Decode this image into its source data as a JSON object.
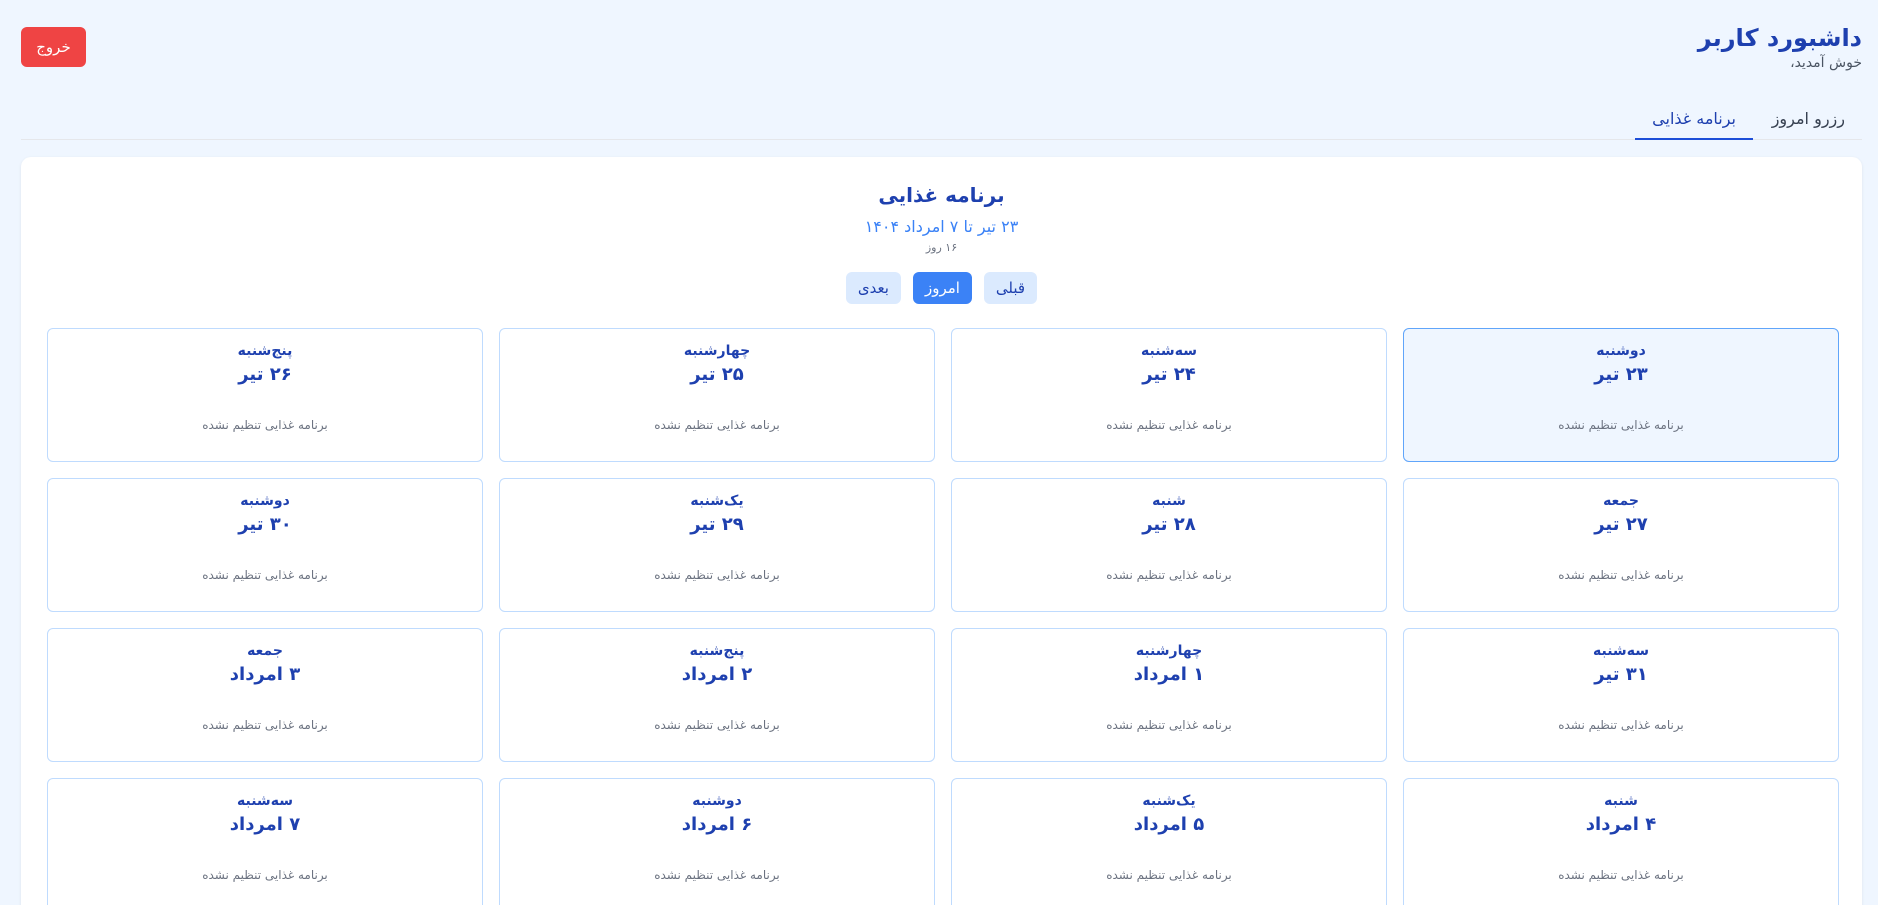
{
  "header": {
    "title": "داشبورد کاربر",
    "subtitle": "خوش آمدید،",
    "logout_label": "خروج"
  },
  "tabs": [
    {
      "label": "رزرو امروز"
    },
    {
      "label": "برنامه غذایی"
    }
  ],
  "plan": {
    "title": "برنامه غذایی",
    "range": "۲۳ تیر تا ۷ امرداد ۱۴۰۴",
    "days_count": "۱۶ روز",
    "nav": {
      "prev_label": "قبلی",
      "today_label": "امروز",
      "next_label": "بعدی"
    }
  },
  "days": [
    {
      "name": "دوشنبه",
      "date": "۲۳ تیر",
      "note": "برنامه غذایی تنظیم نشده"
    },
    {
      "name": "سه‌شنبه",
      "date": "۲۴ تیر",
      "note": "برنامه غذایی تنظیم نشده"
    },
    {
      "name": "چهارشنبه",
      "date": "۲۵ تیر",
      "note": "برنامه غذایی تنظیم نشده"
    },
    {
      "name": "پنج‌شنبه",
      "date": "۲۶ تیر",
      "note": "برنامه غذایی تنظیم نشده"
    },
    {
      "name": "جمعه",
      "date": "۲۷ تیر",
      "note": "برنامه غذایی تنظیم نشده"
    },
    {
      "name": "شنبه",
      "date": "۲۸ تیر",
      "note": "برنامه غذایی تنظیم نشده"
    },
    {
      "name": "یک‌شنبه",
      "date": "۲۹ تیر",
      "note": "برنامه غذایی تنظیم نشده"
    },
    {
      "name": "دوشنبه",
      "date": "۳۰ تیر",
      "note": "برنامه غذایی تنظیم نشده"
    },
    {
      "name": "سه‌شنبه",
      "date": "۳۱ تیر",
      "note": "برنامه غذایی تنظیم نشده"
    },
    {
      "name": "چهارشنبه",
      "date": "۱ امرداد",
      "note": "برنامه غذایی تنظیم نشده"
    },
    {
      "name": "پنج‌شنبه",
      "date": "۲ امرداد",
      "note": "برنامه غذایی تنظیم نشده"
    },
    {
      "name": "جمعه",
      "date": "۳ امرداد",
      "note": "برنامه غذایی تنظیم نشده"
    },
    {
      "name": "شنبه",
      "date": "۴ امرداد",
      "note": "برنامه غذایی تنظیم نشده"
    },
    {
      "name": "یک‌شنبه",
      "date": "۵ امرداد",
      "note": "برنامه غذایی تنظیم نشده"
    },
    {
      "name": "دوشنبه",
      "date": "۶ امرداد",
      "note": "برنامه غذایی تنظیم نشده"
    },
    {
      "name": "سه‌شنبه",
      "date": "۷ امرداد",
      "note": "برنامه غذایی تنظیم نشده"
    }
  ],
  "colors": {
    "page_bg": "#eff6ff",
    "accent": "#1e40af",
    "primary": "#3b82f6",
    "danger": "#ef4444",
    "card_border": "#bfdbfe"
  }
}
